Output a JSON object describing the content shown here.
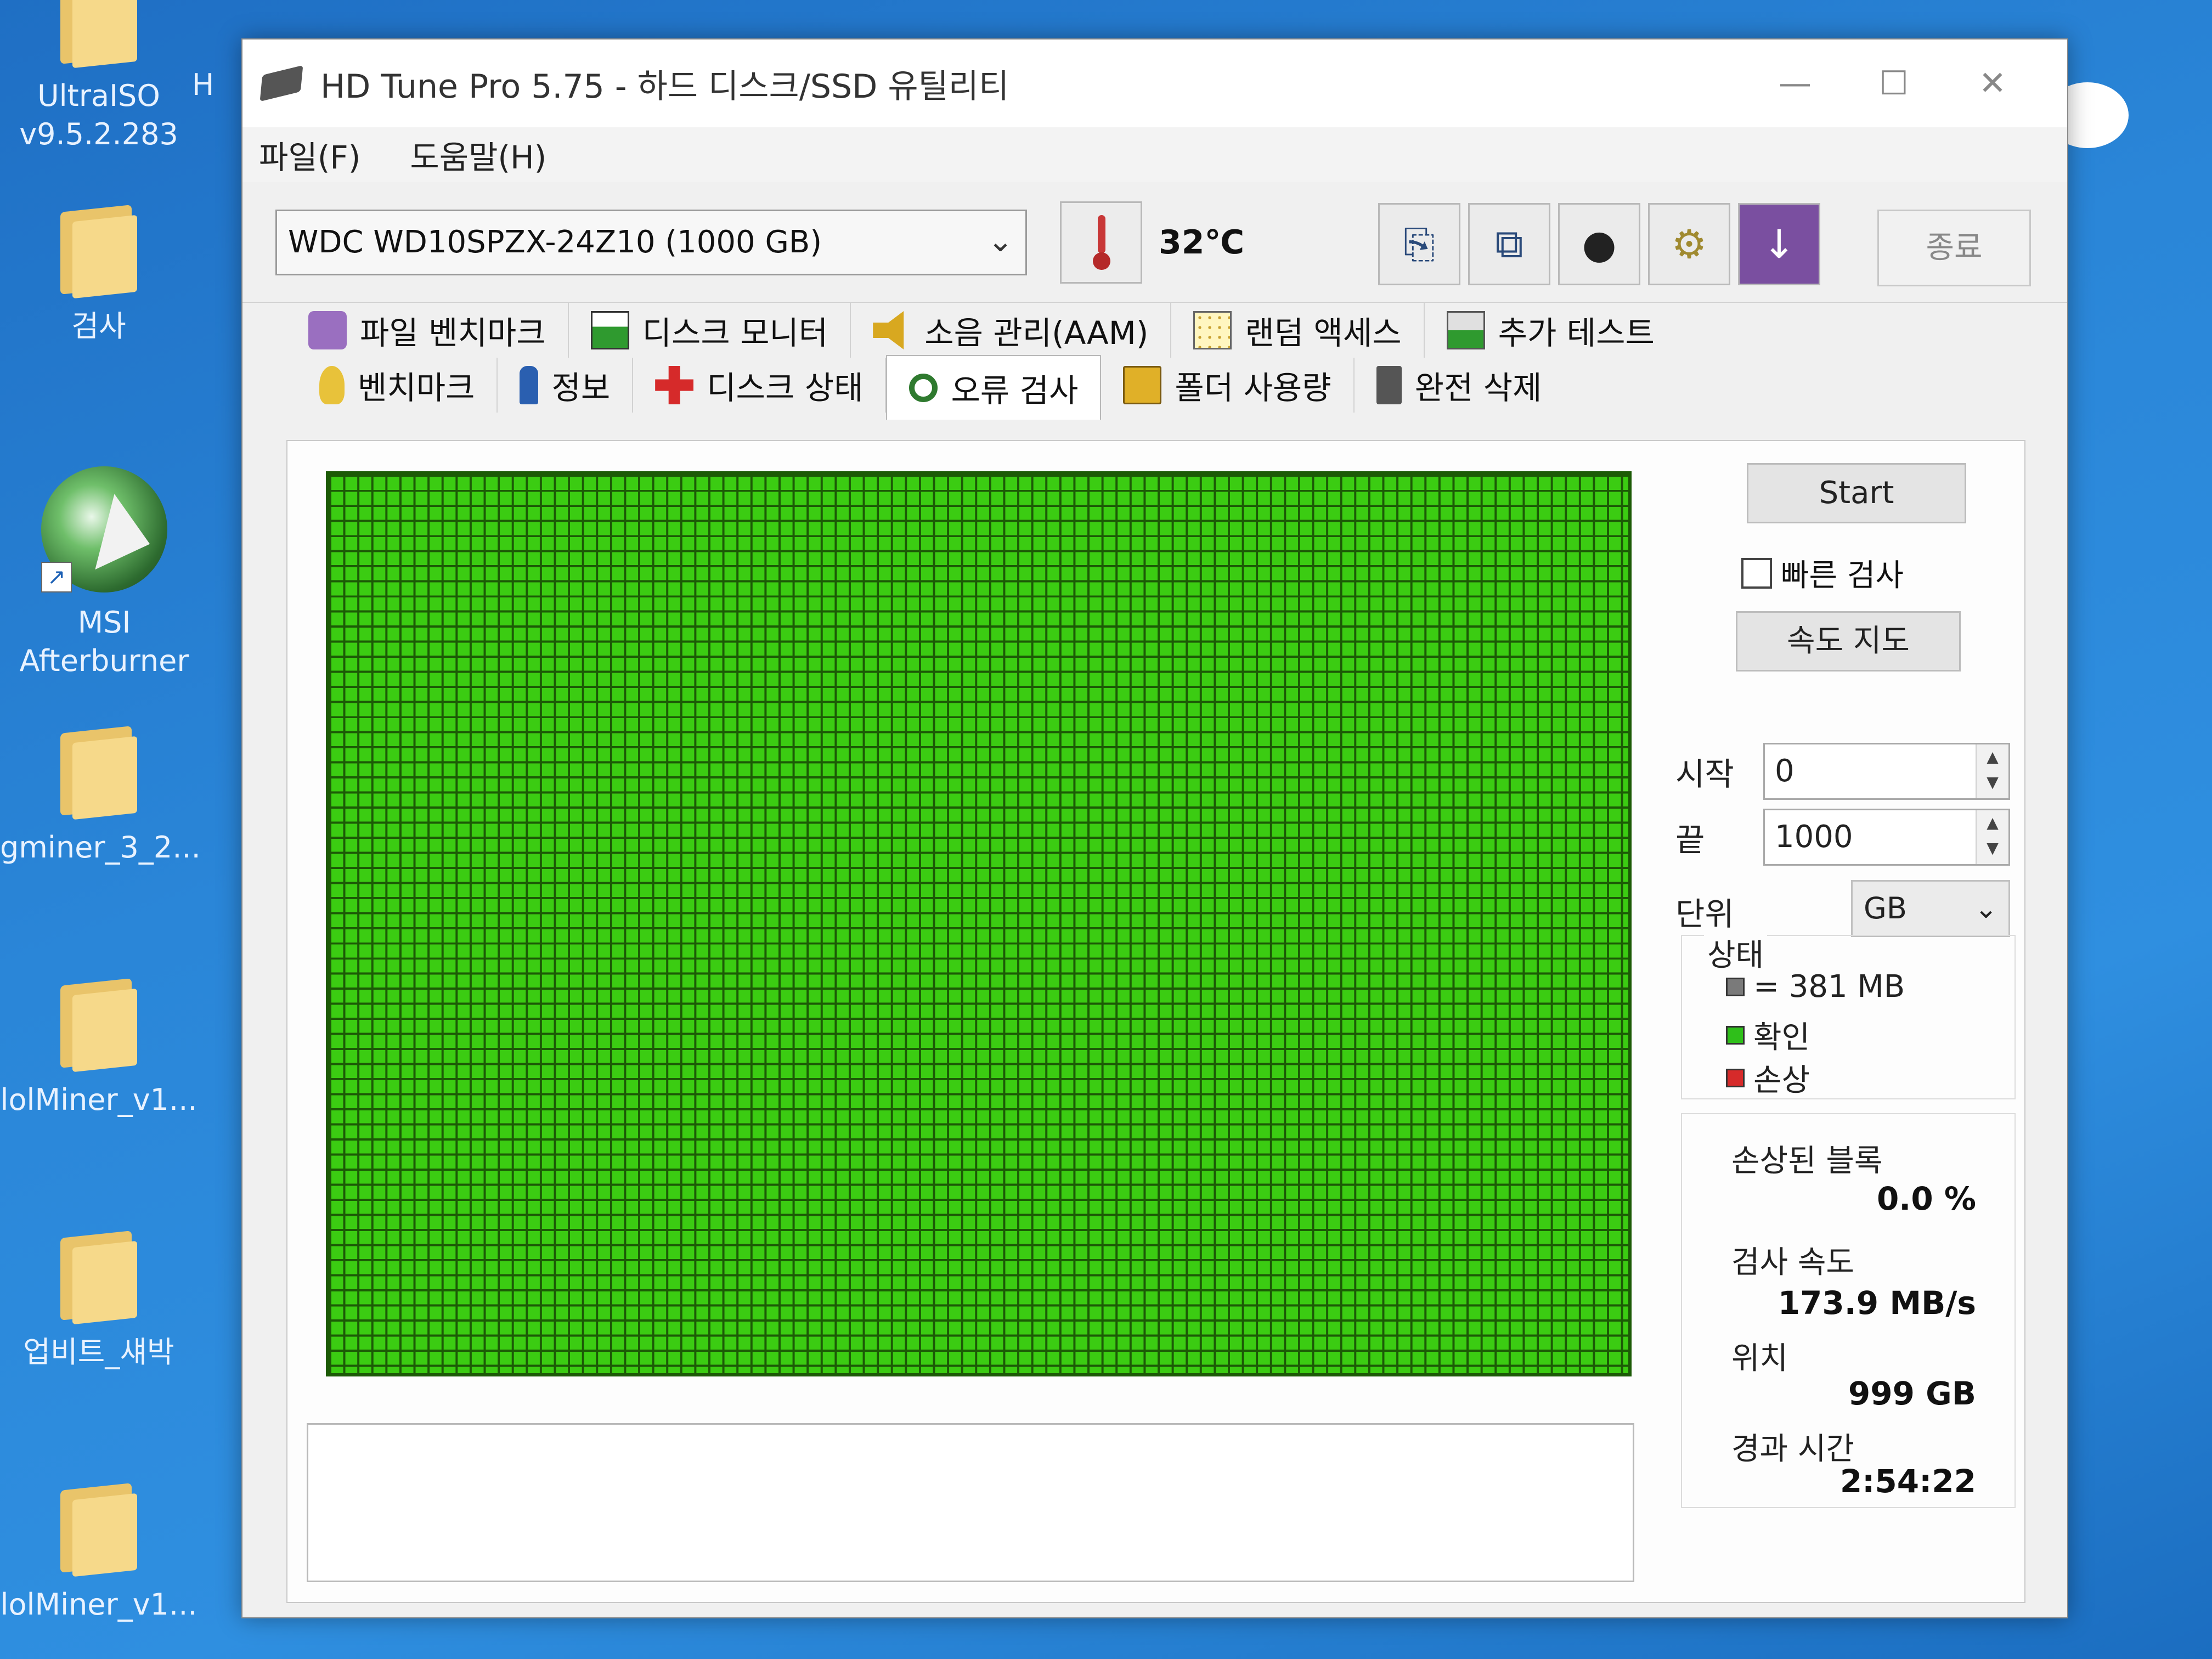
{
  "desktop": {
    "icons": [
      {
        "label": "UltraISO\nv9.5.2.283"
      },
      {
        "label": "검사"
      },
      {
        "label": "MSI\nAfterburner"
      },
      {
        "label": "gminer_3_2..."
      },
      {
        "label": "lolMiner_v1..."
      },
      {
        "label": "업비트_섀박"
      },
      {
        "label": "lolMiner_v1..."
      }
    ],
    "partial_label": "H"
  },
  "window": {
    "title": "HD Tune Pro 5.75 - 하드 디스크/SSD 유틸리티",
    "controls": {
      "minimize": "—",
      "maximize": "☐",
      "close": "✕"
    },
    "menu": [
      "파일(F)",
      "도움말(H)"
    ],
    "toolbar": {
      "drive": "WDC WD10SPZX-24Z10 (1000 GB)",
      "temperature": "32℃",
      "exit_label": "종료"
    },
    "tabs_row1": [
      "파일 벤치마크",
      "디스크 모니터",
      "소음 관리(AAM)",
      "랜덤 액세스",
      "추가 테스트"
    ],
    "tabs_row2": [
      "벤치마크",
      "정보",
      "디스크 상태",
      "오류 검사",
      "폴더 사용량",
      "완전 삭제"
    ],
    "active_tab": "오류 검사",
    "error_scan": {
      "start_label": "Start",
      "quick_scan_label": "빠른 검사",
      "quick_scan_checked": false,
      "speed_map_label": "속도 지도",
      "start_field_label": "시작",
      "start_value": "0",
      "end_field_label": "끝",
      "end_value": "1000",
      "unit_label": "단위",
      "unit_value": "GB",
      "status_title": "상태",
      "legend": [
        {
          "text": "= 381 MB",
          "color": "#7a7a7a"
        },
        {
          "text": "확인",
          "color": "#2fbf1a"
        },
        {
          "text": "손상",
          "color": "#d62a2a"
        }
      ],
      "damaged_blocks_label": "손상된 블록",
      "damaged_blocks_value": "0.0 %",
      "scan_speed_label": "검사 속도",
      "scan_speed_value": "173.9 MB/s",
      "position_label": "위치",
      "position_value": "999 GB",
      "elapsed_label": "경과 시간",
      "elapsed_value": "2:54:22",
      "block_map": {
        "status": "all_ok",
        "ok_color": "#3bcc12",
        "grid_color": "#1c5a06"
      }
    }
  }
}
